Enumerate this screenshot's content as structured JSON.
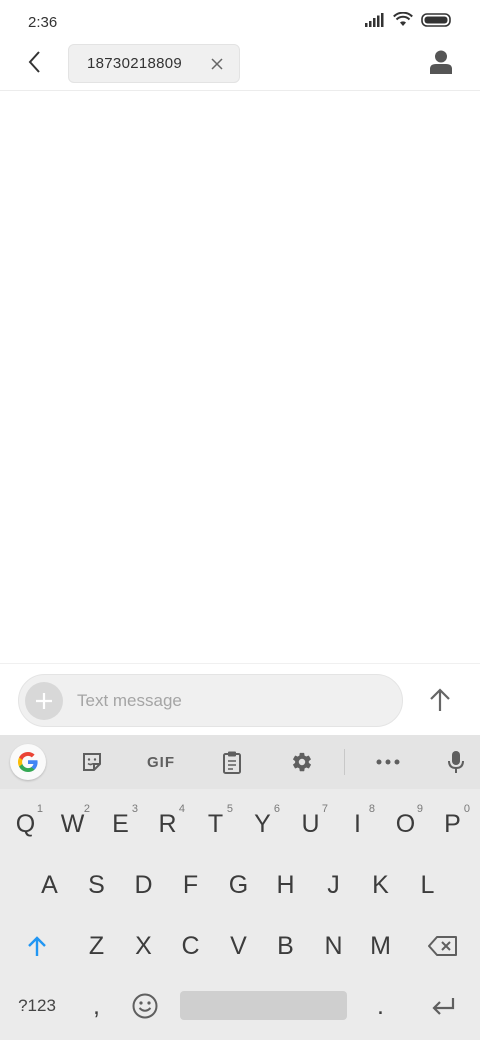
{
  "status_bar": {
    "time": "2:36"
  },
  "header": {
    "recipient": "18730218809"
  },
  "compose": {
    "placeholder": "Text message"
  },
  "keyboard": {
    "toolbar": {
      "gif_label": "GIF"
    },
    "rows": [
      [
        {
          "label": "Q",
          "hint": "1"
        },
        {
          "label": "W",
          "hint": "2"
        },
        {
          "label": "E",
          "hint": "3"
        },
        {
          "label": "R",
          "hint": "4"
        },
        {
          "label": "T",
          "hint": "5"
        },
        {
          "label": "Y",
          "hint": "6"
        },
        {
          "label": "U",
          "hint": "7"
        },
        {
          "label": "I",
          "hint": "8"
        },
        {
          "label": "O",
          "hint": "9"
        },
        {
          "label": "P",
          "hint": "0"
        }
      ],
      [
        {
          "label": "A"
        },
        {
          "label": "S"
        },
        {
          "label": "D"
        },
        {
          "label": "F"
        },
        {
          "label": "G"
        },
        {
          "label": "H"
        },
        {
          "label": "J"
        },
        {
          "label": "K"
        },
        {
          "label": "L"
        }
      ],
      [
        {
          "label": "Z"
        },
        {
          "label": "X"
        },
        {
          "label": "C"
        },
        {
          "label": "V"
        },
        {
          "label": "B"
        },
        {
          "label": "N"
        },
        {
          "label": "M"
        }
      ]
    ],
    "bottom_row": {
      "symbols_label": "?123",
      "comma_label": ",",
      "period_label": "."
    },
    "accent_color": "#2196f3"
  }
}
